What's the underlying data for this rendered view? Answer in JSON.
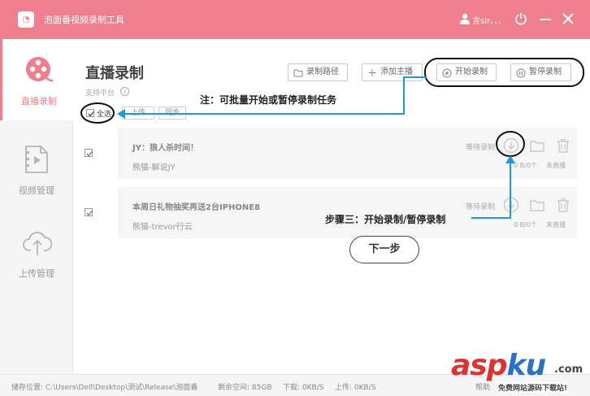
{
  "titlebar": {
    "app_name": "泡面番视频录制工具",
    "user_name": "言sir、、、"
  },
  "sidebar": {
    "items": [
      {
        "label": "直播录制",
        "icon": "film-reel-icon",
        "active": true
      },
      {
        "label": "视频管理",
        "icon": "video-file-icon",
        "active": false
      },
      {
        "label": "上传管理",
        "icon": "cloud-upload-icon",
        "active": false
      }
    ]
  },
  "main": {
    "title": "直播录制",
    "subtitle": "支持平台",
    "record_path_label": "录制路径",
    "add_host_label": "添加主播",
    "start_record_label": "开始录制",
    "pause_record_label": "暂停录制",
    "select_all_label": "全选",
    "upload_label": "上传",
    "sync_label": "同步"
  },
  "rows": [
    {
      "title": "JY：狼人杀时间！",
      "subtitle": "熊猫-解说JY",
      "status": "等待录制",
      "size": "0 B/0个",
      "live_state": "未直播"
    },
    {
      "title": "本周日礼物抽奖再送2台IPHONE8",
      "subtitle": "熊猫-trevor行云",
      "status": "等待录制",
      "size": "0 B/0个",
      "live_state": "未直播"
    }
  ],
  "annotations": {
    "batch_note": "注：可批量开始或暂停录制任务",
    "step3": "步骤三：开始录制/暂停录制"
  },
  "next_button": "下一步",
  "footer": {
    "storage_path": "储存位置: C:\\Users\\Dell\\Desktop\\测试\\Release\\泡面番",
    "free_space": "剩余空间: 85GB",
    "download_speed": "下载: 0KB/S",
    "upload_speed": "上传: 0KB/S",
    "help": "帮助"
  },
  "watermark": {
    "red_part": "asp",
    "blue_part": "ku",
    "dot_com": ".com",
    "tagline": "免费网站源码下载站!"
  },
  "colors": {
    "brand_pink": "#f07f8d",
    "annotation_blue": "#1e9bd7"
  }
}
